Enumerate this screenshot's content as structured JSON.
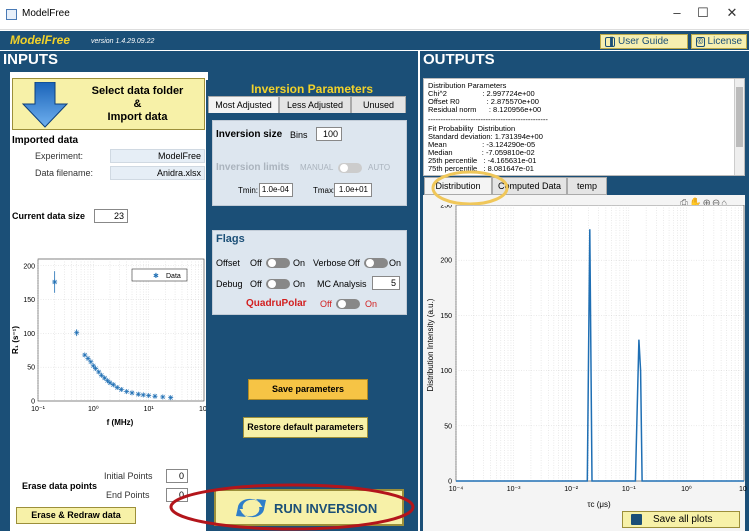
{
  "window": {
    "title": "ModelFree",
    "controls": [
      "–",
      "☐",
      "✕"
    ]
  },
  "banner": {
    "app_name": "ModelFree",
    "version": "version 1.4.29.09.22",
    "user_guide": "User Guide",
    "license": "License"
  },
  "inputs": {
    "header": "INPUTS",
    "select_button": "Select data folder\n&\nImport data",
    "imported_title": "Imported data",
    "experiment_label": "Experiment:",
    "experiment_value": "ModelFree",
    "filename_label": "Data filename:",
    "filename_value": "Anidra.xlsx",
    "current_size_label": "Current data size",
    "current_size_value": "23",
    "erase_title": "Erase data points",
    "initial_label": "Initial Points",
    "initial_value": "0",
    "end_label": "End Points",
    "end_value": "0",
    "erase_button": "Erase & Redraw data"
  },
  "inversion": {
    "title": "Inversion Parameters",
    "tabs": [
      "Most Adjusted",
      "Less Adjusted",
      "Unused"
    ],
    "size_label": "Inversion size",
    "bins_label": "Bins",
    "bins_value": "100",
    "limits_label": "Inversion limits",
    "manual": "MANUAL",
    "auto": "AUTO",
    "tmin_label": "Tmin:",
    "tmin_value": "1.0e-04",
    "tmax_label": "Tmax:",
    "tmax_value": "1.0e+01",
    "flags_title": "Flags",
    "offset_label": "Offset",
    "verbose_label": "Verbose",
    "debug_label": "Debug",
    "off": "Off",
    "on": "On",
    "mc_label": "MC Analysis",
    "mc_value": "5",
    "quadru_label": "QuadruPolar",
    "save_button": "Save parameters",
    "restore_button": "Restore default parameters",
    "run_button": "RUN INVERSION"
  },
  "outputs": {
    "header": "OUTPUTS",
    "text_lines": [
      "Distribution Parameters",
      "Chi^2                 : 2.997724e+00",
      "Offset R0             : 2.875570e+00",
      "Residual norm      : 8.120956e+00",
      "------------------------------------------------",
      "Fit Probability  Distribution",
      "Standard deviation: 1.731394e+00",
      "Mean                 : -3.124290e-05",
      "Median              : -7.059810e-02",
      "25th percentile   : -4.165631e-01",
      "75th percentile   : 8.081647e-01"
    ],
    "tabs": [
      "Distribution",
      "Computed Data",
      "temp"
    ],
    "save_all": "Save all plots"
  },
  "colors": {
    "navy": "#1b4f77",
    "yellow": "#f2d22a",
    "button": "#f7f1a8",
    "line": "#1f6fb4",
    "annotation": "#b3151b",
    "highlight": "#f0c75a"
  },
  "chart_data": [
    {
      "type": "scatter",
      "legend": [
        "Data"
      ],
      "xlabel": "f (MHz)",
      "ylabel": "R₁ (s⁻¹)",
      "xscale": "log",
      "xlim": [
        0.1,
        100
      ],
      "ylim": [
        0,
        210
      ],
      "xticks": [
        "10⁻¹",
        "10⁰",
        "10¹",
        "10²"
      ],
      "yticks": [
        "0",
        "50",
        "100",
        "150",
        "200"
      ],
      "series": [
        {
          "name": "Data",
          "x": [
            0.2,
            0.5,
            0.7,
            0.8,
            0.9,
            1.0,
            1.1,
            1.25,
            1.4,
            1.6,
            1.8,
            2.0,
            2.3,
            2.7,
            3.2,
            4,
            5,
            6.5,
            8,
            10,
            13,
            18,
            25
          ],
          "values": [
            176,
            101,
            68,
            63,
            58,
            52,
            48,
            43,
            38,
            34,
            30,
            27,
            24,
            20,
            17,
            14,
            12,
            10,
            9,
            8,
            7,
            6,
            5
          ]
        }
      ],
      "grid": true
    },
    {
      "type": "line",
      "xlabel": "τc (μs)",
      "ylabel": "Distribution Intensity (a.u.)",
      "xscale": "log",
      "xlim": [
        0.0001,
        10
      ],
      "ylim": [
        0,
        250
      ],
      "xticks": [
        "10⁻⁴",
        "10⁻³",
        "10⁻²",
        "10⁻¹",
        "10⁰",
        "10¹"
      ],
      "yticks": [
        "0",
        "50",
        "100",
        "150",
        "200",
        "250"
      ],
      "series": [
        {
          "x": [
            0.0001,
            0.019,
            0.021,
            0.023,
            0.1,
            0.13,
            0.15,
            0.16,
            0.17,
            10
          ],
          "values": [
            0,
            0,
            228,
            0,
            0,
            0,
            128,
            100,
            0,
            0
          ]
        }
      ],
      "grid": true
    }
  ]
}
